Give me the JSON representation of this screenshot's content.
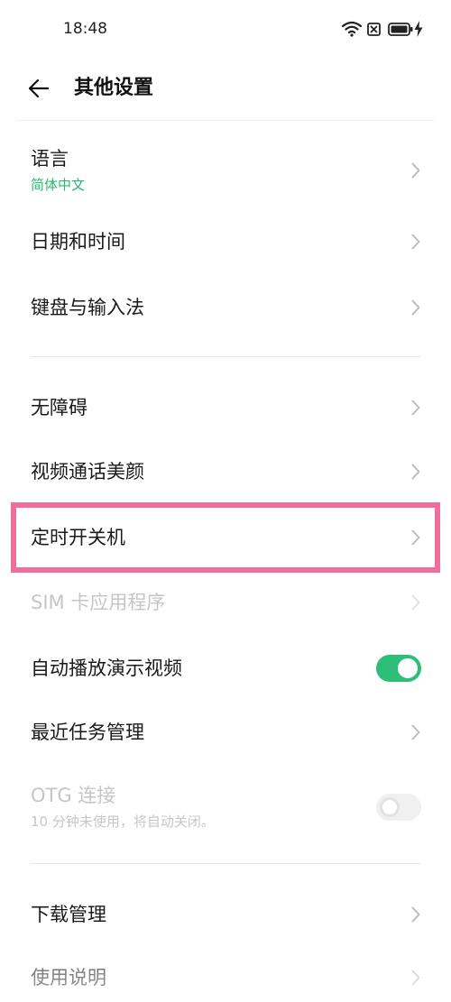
{
  "status_bar": {
    "time": "18:48",
    "icons": [
      "wifi-icon",
      "no-sim-icon",
      "battery-icon",
      "charging-icon"
    ]
  },
  "header": {
    "title": "其他设置",
    "back_icon": "back-arrow-icon"
  },
  "colors": {
    "accent": "#2bb673",
    "toggle_on": "#2dbf78",
    "highlight": "#ef6e9c",
    "text": "#1a1a1a",
    "disabled_text": "#c6c6c6"
  },
  "groups": [
    {
      "items": [
        {
          "label": "语言",
          "subtitle": "简体中文",
          "chevron_icon": "chevron-right-icon"
        },
        {
          "label": "日期和时间",
          "chevron_icon": "chevron-right-icon"
        },
        {
          "label": "键盘与输入法",
          "chevron_icon": "chevron-right-icon"
        }
      ]
    },
    {
      "items": [
        {
          "label": "无障碍",
          "chevron_icon": "chevron-right-icon"
        },
        {
          "label": "视频通话美颜",
          "chevron_icon": "chevron-right-icon"
        },
        {
          "label": "定时开关机",
          "chevron_icon": "chevron-right-icon",
          "highlighted": true
        },
        {
          "label": "SIM 卡应用程序",
          "chevron_icon": "chevron-right-icon",
          "disabled": true
        },
        {
          "label": "自动播放演示视频",
          "toggle": {
            "on": true
          }
        },
        {
          "label": "最近任务管理",
          "chevron_icon": "chevron-right-icon"
        },
        {
          "label": "OTG 连接",
          "subtitle": "10 分钟未使用，将自动关闭。",
          "toggle": {
            "on": false
          },
          "disabled": true
        }
      ]
    },
    {
      "items": [
        {
          "label": "下载管理",
          "chevron_icon": "chevron-right-icon"
        },
        {
          "label": "使用说明",
          "chevron_icon": "chevron-right-icon"
        }
      ]
    }
  ]
}
